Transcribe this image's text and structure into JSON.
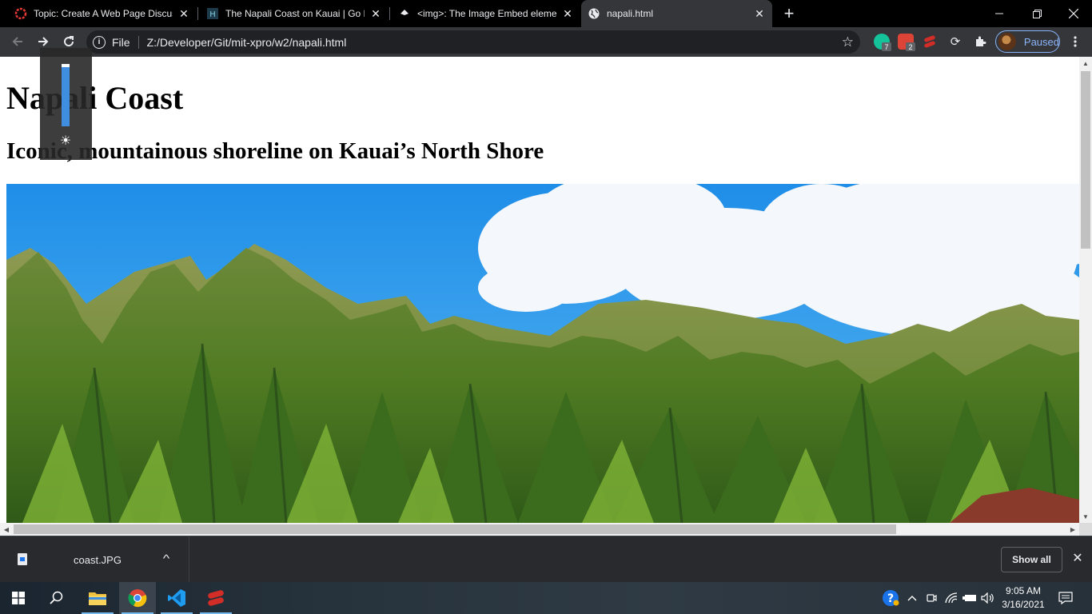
{
  "browser": {
    "tabs": [
      {
        "title": "Topic: Create A Web Page Discus",
        "favicon": "red-ring-icon",
        "active": false
      },
      {
        "title": "The Napali Coast on Kauai | Go H",
        "favicon": "tiki-icon",
        "active": false
      },
      {
        "title": "<img>: The Image Embed eleme",
        "favicon": "mdn-icon",
        "active": false
      },
      {
        "title": "napali.html",
        "favicon": "globe-icon",
        "active": true
      }
    ],
    "new_tab": "+",
    "omnibox": {
      "scheme_label": "File",
      "url": "Z:/Developer/Git/mit-xpro/w2/napali.html"
    },
    "extensions": [
      {
        "name": "grammarly-extension",
        "badge": "7",
        "color": "#15c39a"
      },
      {
        "name": "todo-extension",
        "badge": "2",
        "color": "#db4437"
      },
      {
        "name": "lastpass-extension",
        "badge": "",
        "color": "#d32d27"
      },
      {
        "name": "sync-extension",
        "badge": "",
        "color": "#e8eaed"
      },
      {
        "name": "extensions-puzzle",
        "badge": "",
        "color": "#e8eaed"
      }
    ],
    "profile_status": "Paused"
  },
  "page": {
    "heading": "Napali Coast",
    "subheading": "Iconic, mountainous shoreline on Kauai’s North Shore",
    "image_alt": "Napali Coast mountains",
    "brightness_level": 0.95
  },
  "downloads": {
    "filename": "coast.JPG",
    "show_all_label": "Show all"
  },
  "taskbar": {
    "apps": [
      "file-explorer",
      "chrome",
      "vscode",
      "lastpass"
    ],
    "clock_time": "9:05 AM",
    "clock_date": "3/16/2021"
  }
}
